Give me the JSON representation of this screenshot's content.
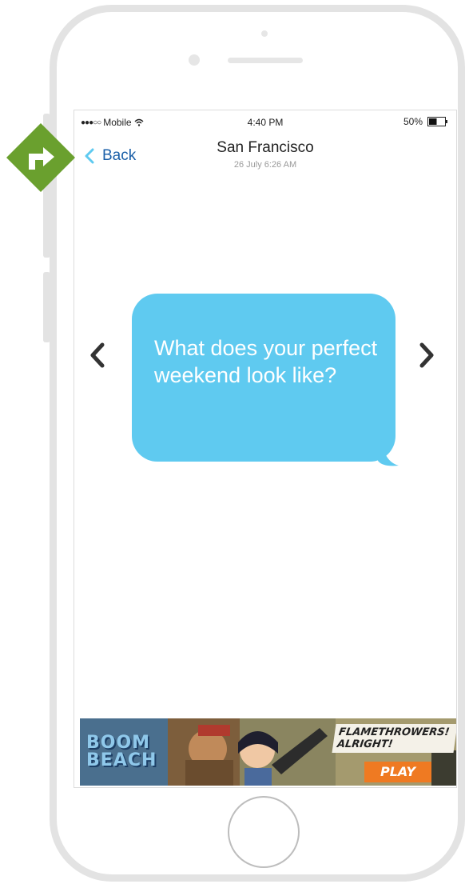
{
  "status_bar": {
    "carrier": "Mobile",
    "time": "4:40 PM",
    "battery": "50%",
    "battery_level": 0.5,
    "signal_bars": 3,
    "signal_total": 5
  },
  "nav": {
    "back_label": "Back",
    "title": "San Francisco",
    "subtitle": "26 July 6:26 AM"
  },
  "message": {
    "text": "What does your perfect weekend look like?"
  },
  "ad": {
    "logo": "BOOM BEACH",
    "tagline": "FLAMETHROWERS! ALRIGHT!",
    "cta": "PLAY"
  },
  "colors": {
    "bubble": "#5fcaf0",
    "back_link": "#1a5fa8",
    "badge": "#6aa02e",
    "frame": "#e3e3e3",
    "ad_cta": "#ef7a22"
  },
  "icons": {
    "back": "chevron-left-icon",
    "prev": "chevron-left-icon",
    "next": "chevron-right-icon",
    "badge": "turn-right-arrow-icon",
    "wifi": "wifi-icon",
    "battery": "battery-icon"
  }
}
